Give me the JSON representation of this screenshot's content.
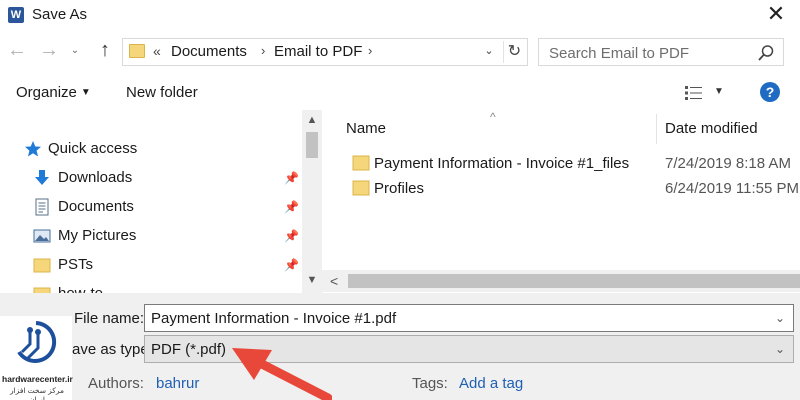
{
  "window": {
    "title": "Save As",
    "app_icon_letter": "W",
    "close_glyph": "✕"
  },
  "nav": {
    "breadcrumb_prefix": "«",
    "breadcrumb": [
      "Documents",
      "Email to PDF"
    ],
    "search_placeholder": "Search Email to PDF"
  },
  "toolbar": {
    "organize_label": "Organize",
    "new_folder_label": "New folder",
    "help_glyph": "?"
  },
  "sidebar": {
    "quick_access_label": "Quick access",
    "items": [
      {
        "label": "Downloads",
        "icon": "download-icon",
        "pinned": true
      },
      {
        "label": "Documents",
        "icon": "document-icon",
        "pinned": true
      },
      {
        "label": "My Pictures",
        "icon": "pictures-icon",
        "pinned": true
      },
      {
        "label": "PSTs",
        "icon": "folder-icon",
        "pinned": true
      },
      {
        "label": "how-to",
        "icon": "folder-icon",
        "pinned": false
      }
    ]
  },
  "file_list": {
    "columns": [
      "Name",
      "Date modified"
    ],
    "rows": [
      {
        "name": "Payment Information - Invoice #1_files",
        "date": "7/24/2019 8:18 AM"
      },
      {
        "name": "Profiles",
        "date": "6/24/2019 11:55 PM"
      }
    ]
  },
  "form": {
    "filename_label": "File name:",
    "filename_value": "Payment Information - Invoice #1.pdf",
    "type_label": "Save as type:",
    "type_value": "PDF (*.pdf)",
    "authors_label": "Authors:",
    "authors_value": "bahrur",
    "tags_label": "Tags:",
    "tags_value": "Add a tag"
  },
  "watermark": {
    "line1": "hardwarecenter.ir",
    "line2": "مرکز سخت افزار ایران"
  },
  "colors": {
    "accent_blue": "#1f6bc4",
    "link_blue": "#1f5fb4",
    "folder_yellow": "#f6d67a",
    "arrow_red": "#e8483a"
  }
}
